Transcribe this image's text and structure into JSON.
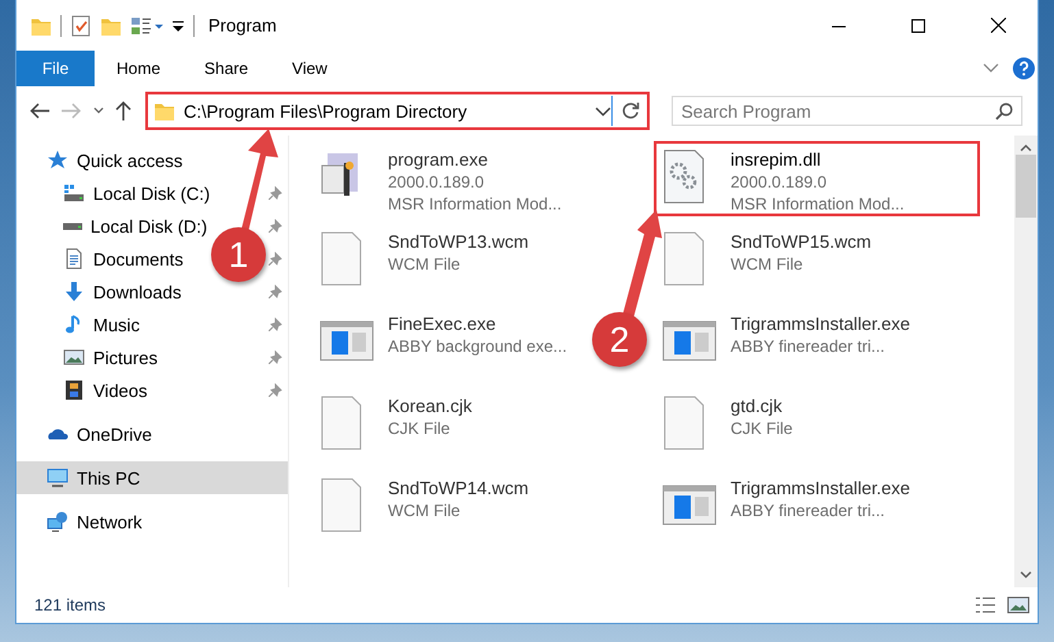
{
  "window": {
    "title": "Program"
  },
  "ribbon_tabs": [
    {
      "label": "File",
      "kind": "file"
    },
    {
      "label": "Home",
      "kind": "tab"
    },
    {
      "label": "Share",
      "kind": "tab"
    },
    {
      "label": "View",
      "kind": "tab"
    }
  ],
  "address_bar": {
    "path": "C:\\Program Files\\Program Directory",
    "highlighted": true
  },
  "search": {
    "placeholder": "Search Program"
  },
  "navigation": [
    {
      "label": "Quick access",
      "kind": "star",
      "pinned": false,
      "selected": false,
      "children": [
        {
          "label": "Local Disk (C:)",
          "kind": "system-drive",
          "pinned": true,
          "selected": false
        },
        {
          "label": "Local Disk (D:)",
          "kind": "drive",
          "pinned": true,
          "selected": false
        },
        {
          "label": "Documents",
          "kind": "documents",
          "pinned": true,
          "selected": false
        },
        {
          "label": "Downloads",
          "kind": "downloads",
          "pinned": true,
          "selected": false
        },
        {
          "label": "Music",
          "kind": "music",
          "pinned": true,
          "selected": false
        },
        {
          "label": "Pictures",
          "kind": "pictures",
          "pinned": true,
          "selected": false
        },
        {
          "label": "Videos",
          "kind": "videos",
          "pinned": true,
          "selected": false
        }
      ]
    },
    {
      "label": "OneDrive",
      "kind": "cloud",
      "pinned": false,
      "selected": false
    },
    {
      "label": "This PC",
      "kind": "pc",
      "pinned": false,
      "selected": true
    },
    {
      "label": "Network",
      "kind": "network",
      "pinned": false,
      "selected": false
    }
  ],
  "files": [
    {
      "name": "program.exe",
      "details": [
        "2000.0.189.0",
        "MSR Information Mod..."
      ],
      "kind": "app",
      "highlighted": false
    },
    {
      "name": "insrepim.dll",
      "details": [
        "2000.0.189.0",
        "MSR Information Mod..."
      ],
      "kind": "dll",
      "highlighted": true
    },
    {
      "name": "SndToWP13.wcm",
      "details": [
        "WCM File"
      ],
      "kind": "blank",
      "highlighted": false
    },
    {
      "name": "SndToWP15.wcm",
      "details": [
        "WCM File"
      ],
      "kind": "blank",
      "highlighted": false
    },
    {
      "name": "FineExec.exe",
      "details": [
        "ABBY background exe..."
      ],
      "kind": "window",
      "highlighted": false
    },
    {
      "name": "TrigrammsInstaller.exe",
      "details": [
        "ABBY finereader tri..."
      ],
      "kind": "window",
      "highlighted": false
    },
    {
      "name": "Korean.cjk",
      "details": [
        "CJK File"
      ],
      "kind": "blank",
      "highlighted": false
    },
    {
      "name": "gtd.cjk",
      "details": [
        "CJK File"
      ],
      "kind": "blank",
      "highlighted": false
    },
    {
      "name": "SndToWP14.wcm",
      "details": [
        "WCM File"
      ],
      "kind": "blank",
      "highlighted": false
    },
    {
      "name": "TrigrammsInstaller.exe",
      "details": [
        "ABBY finereader tri..."
      ],
      "kind": "window",
      "highlighted": false
    }
  ],
  "status_bar": {
    "item_count": "121 items"
  },
  "callouts": [
    {
      "number": "1"
    },
    {
      "number": "2"
    }
  ]
}
